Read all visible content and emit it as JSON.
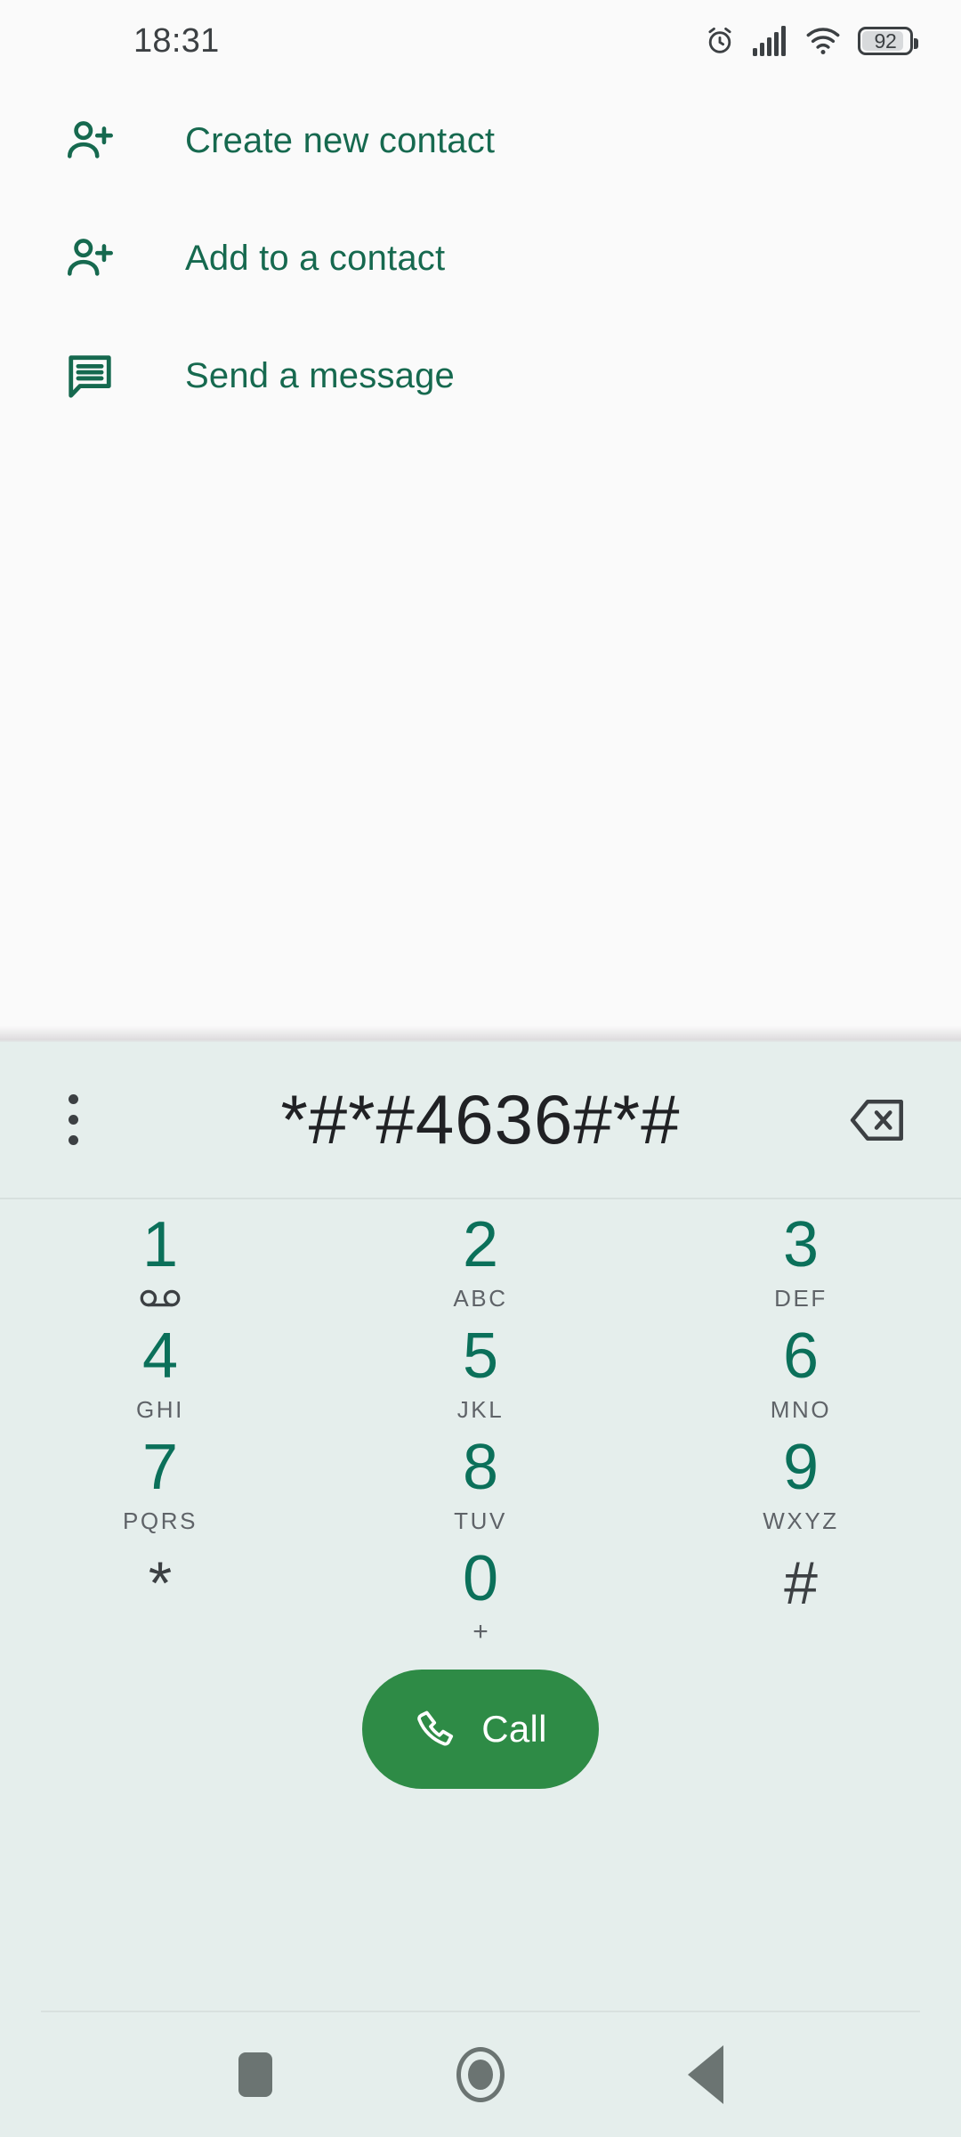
{
  "status_bar": {
    "time": "18:31",
    "battery_percent": "92",
    "icons": [
      "alarm-icon",
      "signal-icon",
      "wifi-icon",
      "battery-icon"
    ]
  },
  "contact_actions": [
    {
      "icon": "person-add-icon",
      "label": "Create new contact"
    },
    {
      "icon": "person-add-icon",
      "label": "Add to a contact"
    },
    {
      "icon": "message-icon",
      "label": "Send a message"
    }
  ],
  "dialer": {
    "number": "*#*#4636#*#",
    "overflow_icon": "more-vert-icon",
    "backspace_icon": "backspace-icon",
    "keys": [
      {
        "digit": "1",
        "sub": "",
        "voicemail": true,
        "dark": false
      },
      {
        "digit": "2",
        "sub": "ABC",
        "voicemail": false,
        "dark": false
      },
      {
        "digit": "3",
        "sub": "DEF",
        "voicemail": false,
        "dark": false
      },
      {
        "digit": "4",
        "sub": "GHI",
        "voicemail": false,
        "dark": false
      },
      {
        "digit": "5",
        "sub": "JKL",
        "voicemail": false,
        "dark": false
      },
      {
        "digit": "6",
        "sub": "MNO",
        "voicemail": false,
        "dark": false
      },
      {
        "digit": "7",
        "sub": "PQRS",
        "voicemail": false,
        "dark": false
      },
      {
        "digit": "8",
        "sub": "TUV",
        "voicemail": false,
        "dark": false
      },
      {
        "digit": "9",
        "sub": "WXYZ",
        "voicemail": false,
        "dark": false
      },
      {
        "digit": "*",
        "sub": "",
        "voicemail": false,
        "dark": true
      },
      {
        "digit": "0",
        "sub": "+",
        "voicemail": false,
        "dark": false
      },
      {
        "digit": "#",
        "sub": "",
        "voicemail": false,
        "dark": true
      }
    ],
    "call_label": "Call",
    "call_icon": "phone-icon"
  },
  "nav_bar": {
    "recents": "recents-square-icon",
    "home": "home-circle-icon",
    "back": "back-triangle-icon"
  },
  "colors": {
    "accent_green": "#16694f",
    "key_green": "#0b705a",
    "call_green": "#2e8b46",
    "panel_bg": "#e5eeec",
    "page_bg": "#fafafa",
    "text_dark": "#202124",
    "text_muted": "#5f6368"
  }
}
